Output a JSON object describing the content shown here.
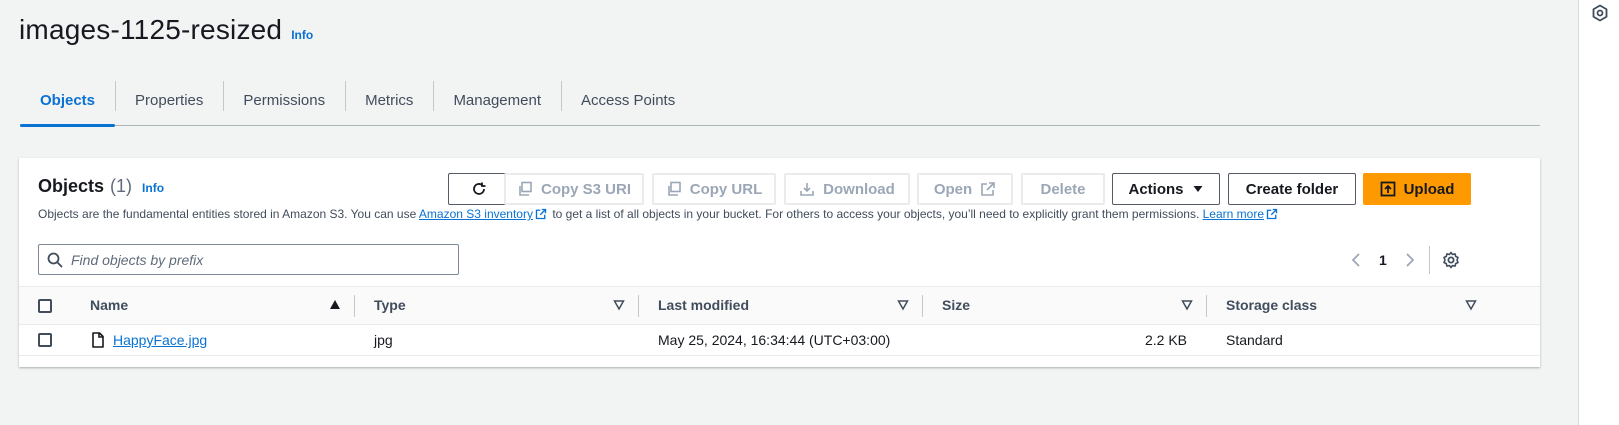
{
  "bucket": {
    "title": "images-1125-resized",
    "info_label": "Info"
  },
  "tabs": [
    {
      "label": "Objects",
      "active": true
    },
    {
      "label": "Properties"
    },
    {
      "label": "Permissions"
    },
    {
      "label": "Metrics"
    },
    {
      "label": "Management"
    },
    {
      "label": "Access Points"
    }
  ],
  "objects_panel": {
    "title": "Objects",
    "count": "(1)",
    "info_label": "Info",
    "description": {
      "part1": "Objects are the fundamental entities stored in Amazon S3. You can use ",
      "link1": "Amazon S3 inventory",
      "part2": " to get a list of all objects in your bucket. For others to access your objects, you’ll need to explicitly grant them permissions. ",
      "link2": "Learn more"
    },
    "buttons": {
      "copy_s3_uri": "Copy S3 URI",
      "copy_url": "Copy URL",
      "download": "Download",
      "open": "Open",
      "delete": "Delete",
      "actions": "Actions",
      "create_folder": "Create folder",
      "upload": "Upload"
    },
    "search": {
      "placeholder": "Find objects by prefix",
      "value": ""
    },
    "pagination": {
      "current_page": "1"
    },
    "columns": {
      "name": "Name",
      "type": "Type",
      "last_modified": "Last modified",
      "size": "Size",
      "storage_class": "Storage class"
    },
    "rows": [
      {
        "name": "HappyFace.jpg",
        "type": "jpg",
        "last_modified": "May 25, 2024, 16:34:44 (UTC+03:00)",
        "size": "2.2 KB",
        "storage_class": "Standard"
      }
    ]
  },
  "colors": {
    "accent_blue": "#0972d3",
    "upload_orange": "#ff9900",
    "page_bg": "#f2f3f3",
    "disabled_text": "#9ba7b6"
  },
  "icons": [
    "refresh-icon",
    "copy-icon",
    "download-icon",
    "external-link-icon",
    "caret-down-icon",
    "upload-icon",
    "search-icon",
    "chevron-left-icon",
    "chevron-right-icon",
    "settings-icon",
    "sort-asc-icon",
    "sort-desc-icon",
    "file-icon",
    "help-panel-icon"
  ]
}
